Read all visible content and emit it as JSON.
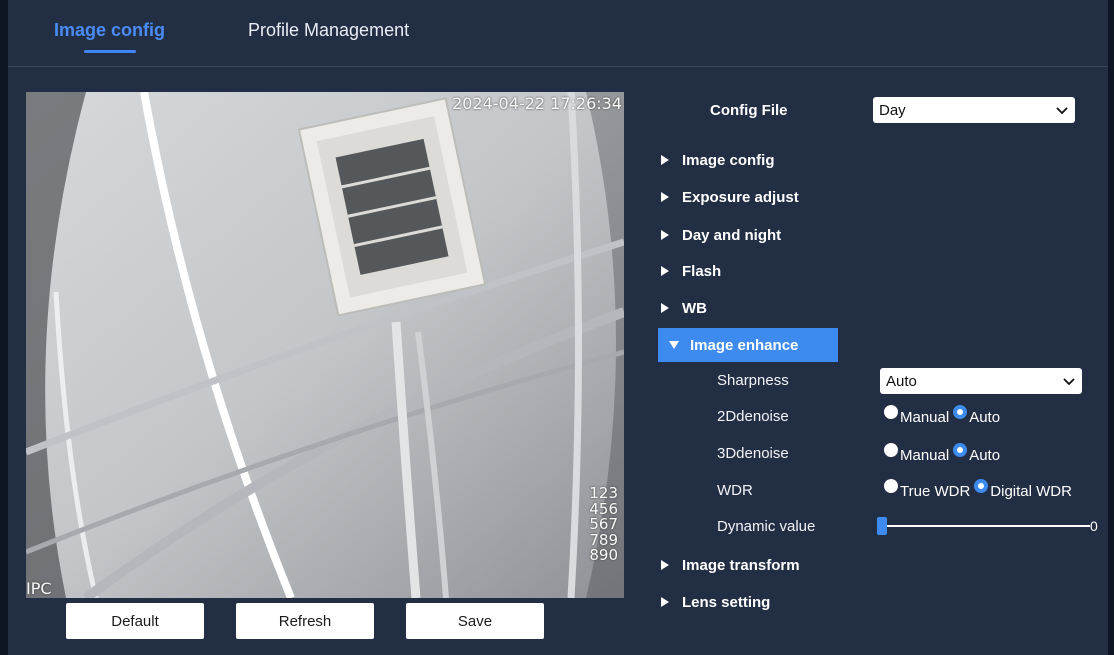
{
  "tabs": [
    {
      "label": "Image config",
      "active": true
    },
    {
      "label": "Profile Management",
      "active": false
    }
  ],
  "preview": {
    "timestamp": "2024-04-22 17:26:34",
    "channel_name": "IPC",
    "osd_lines": [
      "123",
      "456",
      "567",
      "789",
      "890"
    ]
  },
  "buttons": {
    "default_label": "Default",
    "refresh_label": "Refresh",
    "save_label": "Save"
  },
  "config_file": {
    "label": "Config File",
    "value": "Day"
  },
  "menu": [
    {
      "label": "Image config",
      "expanded": false
    },
    {
      "label": "Exposure adjust",
      "expanded": false
    },
    {
      "label": "Day and night",
      "expanded": false
    },
    {
      "label": "Flash",
      "expanded": false
    },
    {
      "label": "WB",
      "expanded": false
    },
    {
      "label": "Image enhance",
      "expanded": true
    },
    {
      "label": "Image transform",
      "expanded": false
    },
    {
      "label": "Lens setting",
      "expanded": false
    }
  ],
  "image_enhance": {
    "sharpness": {
      "label": "Sharpness",
      "value": "Auto"
    },
    "denoise2d": {
      "label": "2Ddenoise",
      "options": [
        "Manual",
        "Auto"
      ],
      "selected": "Auto"
    },
    "denoise3d": {
      "label": "3Ddenoise",
      "options": [
        "Manual",
        "Auto"
      ],
      "selected": "Auto"
    },
    "wdr": {
      "label": "WDR",
      "options": [
        "True WDR",
        "Digital WDR"
      ],
      "selected": "Digital WDR"
    },
    "dynamic_value": {
      "label": "Dynamic value",
      "value": "0"
    }
  },
  "colors": {
    "accent": "#3e8bf0",
    "panel_bg": "#222e43",
    "page_bg": "#0e1522"
  }
}
